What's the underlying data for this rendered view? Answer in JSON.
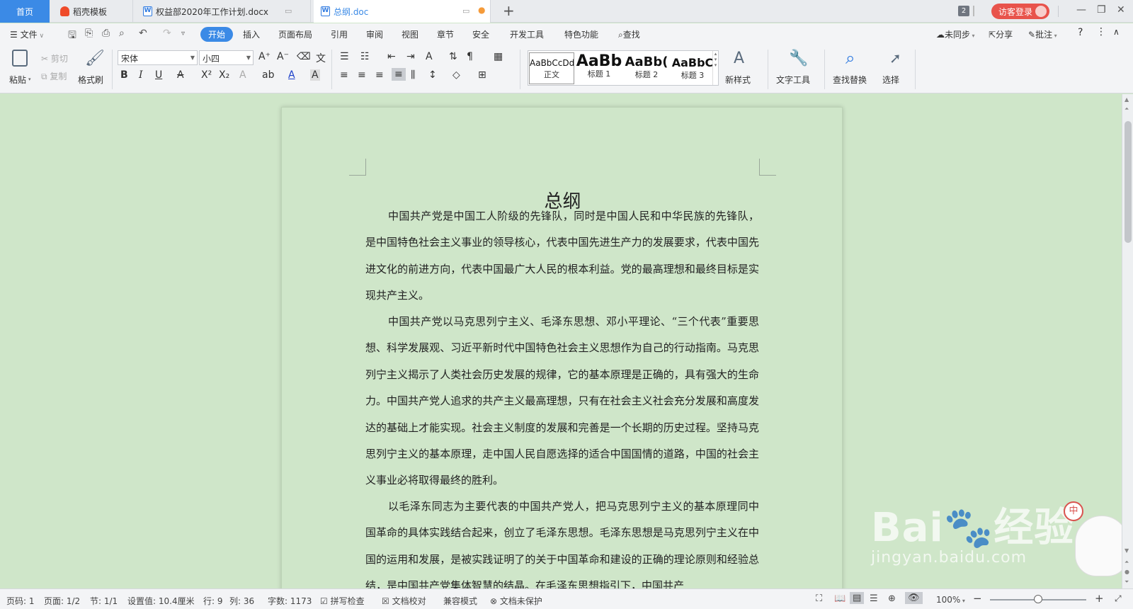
{
  "tabs": {
    "home": "首页",
    "items": [
      {
        "label": "稻壳模板"
      },
      {
        "label": "权益部2020年工作计划.docx"
      },
      {
        "label": "总纲.doc"
      }
    ],
    "window_count": "2",
    "login": "访客登录"
  },
  "menu": {
    "file": "文件",
    "items": [
      "开始",
      "插入",
      "页面布局",
      "引用",
      "审阅",
      "视图",
      "章节",
      "安全",
      "开发工具",
      "特色功能"
    ],
    "search": "查找",
    "sync": "未同步",
    "share": "分享",
    "comment": "批注",
    "help": "?"
  },
  "ribbon": {
    "paste": "粘贴",
    "cut": "剪切",
    "copy": "复制",
    "format_painter": "格式刷",
    "font_name": "宋体",
    "font_size": "小四",
    "styles": [
      {
        "sample": "AaBbCcDd",
        "label": "正文"
      },
      {
        "sample": "AaBb",
        "label": "标题 1"
      },
      {
        "sample": "AaBb(",
        "label": "标题 2"
      },
      {
        "sample": "AaBbC",
        "label": "标题 3"
      }
    ],
    "new_style": "新样式",
    "text_tools": "文字工具",
    "find_replace": "查找替换",
    "select": "选择"
  },
  "document": {
    "title": "总纲",
    "paragraphs": [
      "中国共产党是中国工人阶级的先锋队，同时是中国人民和中华民族的先锋队，是中国特色社会主义事业的领导核心，代表中国先进生产力的发展要求，代表中国先进文化的前进方向，代表中国最广大人民的根本利益。党的最高理想和最终目标是实现共产主义。",
      "中国共产党以马克思列宁主义、毛泽东思想、邓小平理论、“三个代表”重要思想、科学发展观、习近平新时代中国特色社会主义思想作为自己的行动指南。马克思列宁主义揭示了人类社会历史发展的规律，它的基本原理是正确的，具有强大的生命力。中国共产党人追求的共产主义最高理想，只有在社会主义社会充分发展和高度发达的基础上才能实现。社会主义制度的发展和完善是一个长期的历史过程。坚持马克思列宁主义的基本原理，走中国人民自愿选择的适合中国国情的道路，中国的社会主义事业必将取得最终的胜利。",
      "以毛泽东同志为主要代表的中国共产党人，把马克思列宁主义的基本原理同中国革命的具体实践结合起来，创立了毛泽东思想。毛泽东思想是马克思列宁主义在中国的运用和发展，是被实践证明了的关于中国革命和建设的正确的理论原则和经验总结，是中国共产党集体智慧的结晶。在毛泽东思想指引下，中国共产"
    ]
  },
  "status": {
    "page_code": "页码: 1",
    "pages": "页面: 1/2",
    "section": "节: 1/1",
    "setting": "设置值: 10.4厘米",
    "row": "行: 9",
    "col": "列: 36",
    "word_count": "字数: 1173",
    "spell_check": "拼写检查",
    "doc_proof": "文档校对",
    "compat_mode": "兼容模式",
    "unprotected": "文档未保护",
    "zoom": "100%"
  },
  "watermark": {
    "brand": "Bai",
    "brand2": "经验",
    "url": "jingyan.baidu.com",
    "badge": "中"
  }
}
